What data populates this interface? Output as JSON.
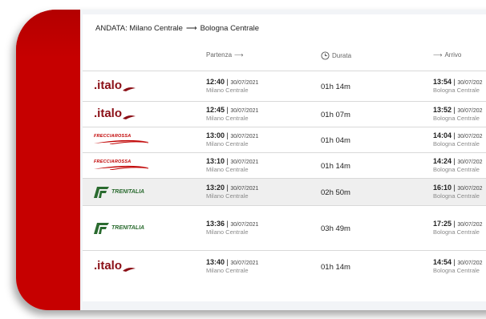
{
  "route_header": {
    "label": "ANDATA: Milano Centrale",
    "destination": "Bologna Centrale",
    "arrow": "⟶"
  },
  "columns": {
    "departure": "Partenza",
    "duration": "Durata",
    "arrival": "Arrivo",
    "arrow": "⟶"
  },
  "colors": {
    "brand_red": "#c60000",
    "italo": "#8b0f16",
    "trenitalia_green": "#2a6b2f"
  },
  "trains": [
    {
      "operator": "italo",
      "logo_text": ".italo",
      "dep_time": "12:40",
      "dep_date": "30/07/2021",
      "dep_station": "Milano Centrale",
      "duration": "01h 14m",
      "arr_time": "13:54",
      "arr_date": "30/07/202",
      "arr_station": "Bologna Centrale"
    },
    {
      "operator": "italo",
      "logo_text": ".italo",
      "dep_time": "12:45",
      "dep_date": "30/07/2021",
      "dep_station": "Milano Centrale",
      "duration": "01h 07m",
      "arr_time": "13:52",
      "arr_date": "30/07/202",
      "arr_station": "Bologna Centrale"
    },
    {
      "operator": "frecciarossa",
      "logo_text": "FRECCIAROSSA",
      "dep_time": "13:00",
      "dep_date": "30/07/2021",
      "dep_station": "Milano Centrale",
      "duration": "01h 04m",
      "arr_time": "14:04",
      "arr_date": "30/07/202",
      "arr_station": "Bologna Centrale"
    },
    {
      "operator": "frecciarossa",
      "logo_text": "FRECCIAROSSA",
      "dep_time": "13:10",
      "dep_date": "30/07/2021",
      "dep_station": "Milano Centrale",
      "duration": "01h 14m",
      "arr_time": "14:24",
      "arr_date": "30/07/202",
      "arr_station": "Bologna Centrale"
    },
    {
      "operator": "trenitalia",
      "logo_text": "TRENITALIA",
      "dep_time": "13:20",
      "dep_date": "30/07/2021",
      "dep_station": "Milano Centrale",
      "duration": "02h 50m",
      "arr_time": "16:10",
      "arr_date": "30/07/202",
      "arr_station": "Bologna Centrale",
      "selected": true
    },
    {
      "operator": "trenitalia",
      "logo_text": "TRENITALIA",
      "dep_time": "13:36",
      "dep_date": "30/07/2021",
      "dep_station": "Milano Centrale",
      "duration": "03h 49m",
      "arr_time": "17:25",
      "arr_date": "30/07/202",
      "arr_station": "Bologna Centrale"
    },
    {
      "operator": "italo",
      "logo_text": ".italo",
      "dep_time": "13:40",
      "dep_date": "30/07/2021",
      "dep_station": "Milano Centrale",
      "duration": "01h 14m",
      "arr_time": "14:54",
      "arr_date": "30/07/202",
      "arr_station": "Bologna Centrale"
    }
  ]
}
